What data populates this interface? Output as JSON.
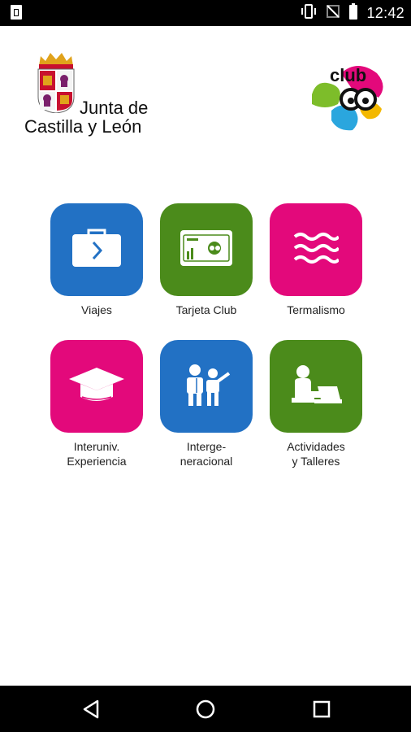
{
  "status_bar": {
    "time": "12:42",
    "icons": [
      "sim-card-icon",
      "vibrate-icon",
      "no-signal-icon",
      "battery-icon"
    ]
  },
  "header": {
    "org_line1": "Junta de",
    "org_line2": "Castilla y León",
    "club_logo_text": "club"
  },
  "colors": {
    "blue": "#2271c4",
    "green": "#4b8b1b",
    "pink": "#e3097b"
  },
  "menu": [
    {
      "label": [
        "Viajes"
      ],
      "icon": "suitcase-icon",
      "color": "blue"
    },
    {
      "label": [
        "Tarjeta Club"
      ],
      "icon": "card-icon",
      "color": "green"
    },
    {
      "label": [
        "Termalismo"
      ],
      "icon": "waves-icon",
      "color": "pink"
    },
    {
      "label": [
        "Interuniv.",
        "Experiencia"
      ],
      "icon": "graduation-cap-icon",
      "color": "pink"
    },
    {
      "label": [
        "Interge-",
        "neracional"
      ],
      "icon": "people-icon",
      "color": "blue"
    },
    {
      "label": [
        "Actividades",
        "y Talleres"
      ],
      "icon": "person-laptop-icon",
      "color": "green"
    }
  ],
  "nav_bar": [
    "back-icon",
    "home-icon",
    "recents-icon"
  ]
}
